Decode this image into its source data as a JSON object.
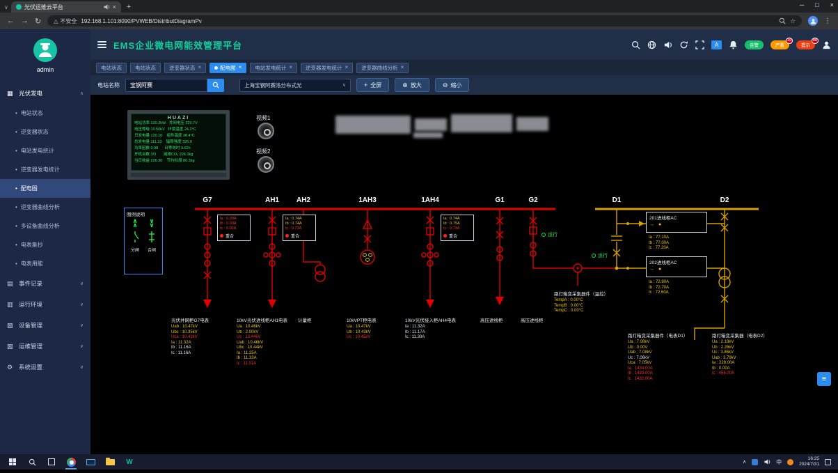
{
  "browser": {
    "tab_title": "光伏运维云平台",
    "security": "不安全",
    "url": "192.168.1.101:8090/PVWEB/DistributDiagramPv"
  },
  "header": {
    "title": "EMS企业微电网能效管理平台",
    "pills": [
      {
        "label": "告警",
        "count": ""
      },
      {
        "label": "严重",
        "count": "19"
      },
      {
        "label": "提示",
        "count": "88"
      }
    ]
  },
  "tabs": [
    {
      "label": "电站状态"
    },
    {
      "label": "电站状态"
    },
    {
      "label": "逆变器状态"
    },
    {
      "label": "配电图"
    },
    {
      "label": "电站发电统计"
    },
    {
      "label": "逆变器发电统计"
    },
    {
      "label": "逆变器曲线分析"
    }
  ],
  "toolbar": {
    "station_label": "电站名称",
    "search_value": "宝钢阿赛",
    "station_select": "上海宝钢阿赛洛分布式光",
    "fullscreen": "全屏",
    "zoom_in": "放大",
    "zoom_out": "缩小"
  },
  "sidebar": {
    "user": "admin",
    "group_pv": "光伏发电",
    "pv_children": [
      {
        "label": "电站状态",
        "cls": ""
      },
      {
        "label": "逆变器状态",
        "cls": ""
      },
      {
        "label": "电站发电统计",
        "cls": ""
      },
      {
        "label": "逆变器发电统计",
        "cls": ""
      },
      {
        "label": "配电图",
        "cls": "active"
      },
      {
        "label": "逆变器曲线分析",
        "cls": ""
      },
      {
        "label": "多设备曲线分析",
        "cls": ""
      },
      {
        "label": "电表集抄",
        "cls": ""
      },
      {
        "label": "电表用能",
        "cls": ""
      }
    ],
    "groups": [
      {
        "label": "事件记录",
        "icon": "▤"
      },
      {
        "label": "运行环境",
        "icon": "▥"
      },
      {
        "label": "设备管理",
        "icon": "▧"
      },
      {
        "label": "运维管理",
        "icon": "▨"
      },
      {
        "label": "系统设置",
        "icon": "⚙"
      }
    ]
  },
  "diagram": {
    "monitor": {
      "title": "HUAZI",
      "lines": [
        "电站功率 120.2kW   并网电压 220.7V",
        "电压等级 10.50kV   环境温度 24.2°C",
        "日发电量 120.10    组件温度 28.4°C",
        "总发电量 111.10    辐照强度 326.0",
        "功率因数 0.98      日等效时 3.62h",
        "开机台数 3/3       减排CO₂ 226.3kg",
        "当日收益 226.30    节约标煤 86.3kg"
      ]
    },
    "video1": "视频1",
    "video2": "视频2",
    "legend": {
      "title": "图例说明",
      "open_label": "分闸",
      "close_label": "合闸"
    },
    "buses": {
      "g7": "G7",
      "ah1": "AH1",
      "ah2": "AH2",
      "ah3": "1AH3",
      "ah4": "1AH4",
      "g1": "G1",
      "g2": "G2",
      "d1": "D1",
      "d2": "D2"
    },
    "run_label": "运行",
    "breaker_boxes": [
      {
        "lines": [
          {
            "t": "Ia : 0.00A",
            "c": "r"
          },
          {
            "t": "Ib : 0.00A",
            "c": "r"
          },
          {
            "t": "Ic : 0.00A",
            "c": "r"
          }
        ],
        "status": "重合"
      },
      {
        "lines": [
          {
            "t": "Ia : 0.74A",
            "c": "y"
          },
          {
            "t": "Ib : 0.74A",
            "c": "y"
          },
          {
            "t": "Ic : 0.73A",
            "c": "r"
          }
        ],
        "status": "重合"
      },
      {
        "lines": [
          {
            "t": "Ia : 0.74A",
            "c": "y"
          },
          {
            "t": "Ib : 0.75A",
            "c": "y"
          },
          {
            "t": "Ic : 0.73A",
            "c": "r"
          }
        ],
        "status": "重合"
      }
    ],
    "incoming_boxes": [
      {
        "title": "201进线柜AC",
        "lines": [
          {
            "t": "Ia : 77.10A",
            "c": "y"
          },
          {
            "t": "Ib : 77.00A",
            "c": "y"
          },
          {
            "t": "Ic : 77.20A",
            "c": "y"
          }
        ]
      },
      {
        "title": "202进线柜AC",
        "lines": [
          {
            "t": "Ia : 72.90A",
            "c": "y"
          },
          {
            "t": "Ib : 72.70A",
            "c": "y"
          },
          {
            "t": "Ic : 72.60A",
            "c": "y"
          }
        ]
      }
    ],
    "temp_box": {
      "title": "路灯箱变采集器件（温控）",
      "lines": [
        {
          "t": "TempA : 0.00°C",
          "c": "y"
        },
        {
          "t": "TempB : 0.00°C",
          "c": "y"
        },
        {
          "t": "TempC : 0.00°C",
          "c": "y"
        }
      ]
    },
    "meters": [
      {
        "title": "光伏并网柜G7电表",
        "lines": [
          {
            "t": "Uab : 10.47kV",
            "c": "y"
          },
          {
            "t": "Ubc : 10.35kV",
            "c": "y"
          },
          {
            "t": "Uca : 10.41kV",
            "c": "r"
          },
          {
            "t": "Ia : 11.32A",
            "c": "y"
          },
          {
            "t": "Ib : 11.16A",
            "c": "w"
          },
          {
            "t": "Ic : 11.16A",
            "c": "w"
          }
        ]
      },
      {
        "title": "10kV光伏进线柜AH1电表",
        "lines": [
          {
            "t": "Ua : 10.46kV",
            "c": "y"
          },
          {
            "t": "Ub : 2.00kV",
            "c": "y"
          },
          {
            "t": "Uc : 10.44kV",
            "c": "r"
          },
          {
            "t": "Uab : 10.46kV",
            "c": "y"
          },
          {
            "t": "Ubc : 10.44kV",
            "c": "y"
          },
          {
            "t": "Ia : 11.25A",
            "c": "y"
          },
          {
            "t": "Ib : 11.33A",
            "c": "y"
          },
          {
            "t": "Ic : 11.31A",
            "c": "r"
          }
        ]
      },
      {
        "title": "计量柜",
        "lines": []
      },
      {
        "title": "10kVPT柜电表",
        "lines": [
          {
            "t": "Ua : 10.47kV",
            "c": "y"
          },
          {
            "t": "Ub : 10.43kV",
            "c": "y"
          },
          {
            "t": "Uc : 10.45kV",
            "c": "r"
          }
        ]
      },
      {
        "title": "10kV光伏接入柜AH4电表",
        "lines": [
          {
            "t": "Ia : 11.32A",
            "c": "w"
          },
          {
            "t": "Ib : 11.17A",
            "c": "w"
          },
          {
            "t": "Ic : 11.30A",
            "c": "w"
          }
        ]
      },
      {
        "title": "高压进线柜",
        "lines": []
      },
      {
        "title": "高压进线柜",
        "lines": []
      },
      {
        "title": "路灯箱变采集器件（电表D1）",
        "lines": [
          {
            "t": "Ua : 7.08kV",
            "c": "y"
          },
          {
            "t": "Ub : 0.00V",
            "c": "y"
          },
          {
            "t": "Uab : 7.08kV",
            "c": "y"
          },
          {
            "t": "Uc : 7.06kV",
            "c": "w"
          },
          {
            "t": "Uca : 7.05kV",
            "c": "y"
          },
          {
            "t": "Ia : 1434.00A",
            "c": "r"
          },
          {
            "t": "Ib : 1433.00A",
            "c": "r"
          },
          {
            "t": "Ic : 1432.00A",
            "c": "r"
          }
        ]
      },
      {
        "title": "路灯箱变采集器（电表D2）",
        "lines": [
          {
            "t": "Ua : 2.19kV",
            "c": "y"
          },
          {
            "t": "Ub : 2.26kV",
            "c": "y"
          },
          {
            "t": "Uc : 3.86kV",
            "c": "y"
          },
          {
            "t": "Uab : 3.79kV",
            "c": "y"
          },
          {
            "t": "Ia : 228.00A",
            "c": "y"
          },
          {
            "t": "Ib : 0.00A",
            "c": "y"
          },
          {
            "t": "Ic : 456.00A",
            "c": "r"
          }
        ]
      }
    ]
  },
  "taskbar": {
    "time": "16:25",
    "date": "2024/7/31",
    "ime": "中"
  },
  "colors": {
    "accent": "#2d8cf0",
    "title_green": "#10cf9b",
    "alarm_green": "#19be6b",
    "alarm_orange": "#ff9900",
    "alarm_red": "#ed3f14",
    "wire_red": "#e00000",
    "wire_yellow": "#d8a000",
    "run_green": "#21e54e"
  }
}
